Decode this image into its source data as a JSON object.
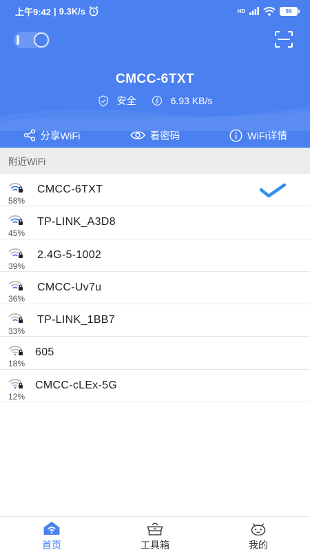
{
  "status_bar": {
    "time": "上午9:42",
    "speed": "9.3K/s",
    "network": "HD",
    "battery": "99"
  },
  "header": {
    "ssid": "CMCC-6TXT",
    "security_label": "安全",
    "speed_label": "6.93 KB/s",
    "actions": [
      {
        "label": "分享WiFi",
        "icon": "share-icon"
      },
      {
        "label": "看密码",
        "icon": "eye-icon"
      },
      {
        "label": "WiFi详情",
        "icon": "info-icon"
      }
    ]
  },
  "section_title": "附近WiFi",
  "wifi_list": [
    {
      "ssid": "CMCC-6TXT",
      "signal": "58%",
      "locked": true,
      "connected": true
    },
    {
      "ssid": "TP-LINK_A3D8",
      "signal": "45%",
      "locked": true
    },
    {
      "ssid": "2.4G-5-1002",
      "signal": "39%",
      "locked": true
    },
    {
      "ssid": "CMCC-Uv7u",
      "signal": "36%",
      "locked": true
    },
    {
      "ssid": "TP-LINK_1BB7",
      "signal": "33%",
      "locked": true
    },
    {
      "ssid": "605",
      "signal": "18%",
      "locked": true
    },
    {
      "ssid": "CMCC-cLEx-5G",
      "signal": "12%",
      "locked": true
    }
  ],
  "bottom_nav": [
    {
      "label": "首页",
      "icon": "home-wifi-icon",
      "active": true
    },
    {
      "label": "工具箱",
      "icon": "toolbox-icon",
      "active": false
    },
    {
      "label": "我的",
      "icon": "android-face-icon",
      "active": false
    }
  ],
  "colors": {
    "primary": "#4a80f0",
    "check": "#2f8ff0",
    "active_nav": "#3b7bf0"
  }
}
